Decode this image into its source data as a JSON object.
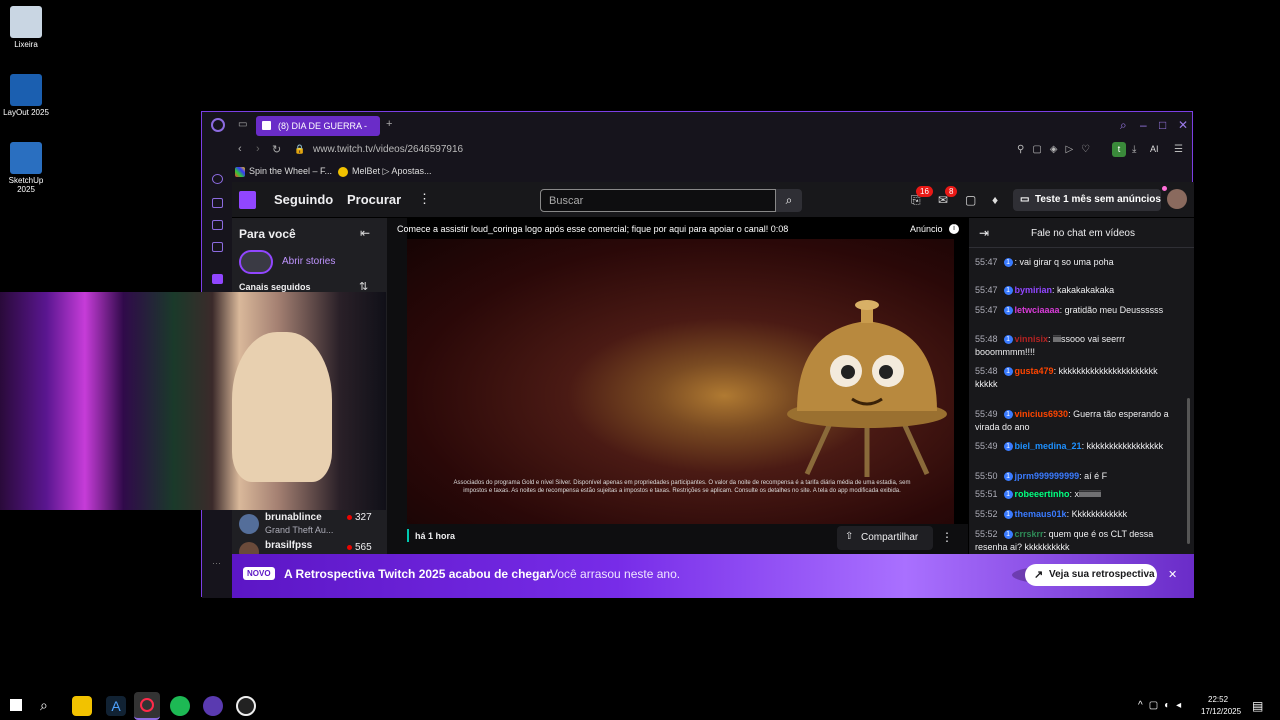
{
  "desktop": {
    "icons": [
      "Lixeira",
      "LayOut 2025",
      "SketchUp 2025"
    ]
  },
  "browser": {
    "tab_title": "(8) DIA DE GUERRA - ",
    "url": "www.twitch.tv/videos/2646597916",
    "bookmarks": [
      "Spin the Wheel – F...",
      "MelBet ▷ Apostas..."
    ],
    "ai_label": "AI"
  },
  "twitch": {
    "nav": {
      "following": "Seguindo",
      "browse": "Procurar",
      "search_placeholder": "Buscar",
      "notif_count": "16",
      "inbox_count": "8",
      "turbo": "Teste 1 mês sem anúncios"
    },
    "left": {
      "for_you": "Para você",
      "stories": "Abrir stories",
      "followed": "Canais seguidos",
      "channels": [
        {
          "name": "brunablince",
          "game": "Grand Theft Au...",
          "viewers": "327"
        },
        {
          "name": "brasilfpss",
          "viewers": "565"
        }
      ]
    },
    "video": {
      "ad_banner": "Comece a assistir loud_coringa logo após esse comercial; fique por aqui para apoiar o canal! 0:08",
      "ad_label": "Anúncio",
      "disclaimer": "Associados do programa Gold e nível Silver. Disponível apenas em propriedades participantes. O valor da noite de recompensa é a tarifa diária média de uma estadia, sem impostos e taxas. As noites de recompensa estão sujeitas a impostos e taxas. Restrições se aplicam. Consulte os detalhes no site. A tela do app modificada exibida.",
      "time_ago": "há 1 hora",
      "share": "Compartilhar"
    },
    "chat": {
      "header": "Fale no chat em vídeos",
      "messages": [
        {
          "time": "55:47",
          "user": "",
          "color": "#3a7bff",
          "text": ": vai girar q so uma poha"
        },
        {
          "time": "55:47",
          "user": "bymirian",
          "color": "#9146ff",
          "text": ": kakakakakaka"
        },
        {
          "time": "55:47",
          "user": "letwciaaaa",
          "color": "#d83cd8",
          "text": ": gratidão meu Deussssss"
        },
        {
          "time": "55:48",
          "user": "vinnisix",
          "color": "#b22222",
          "text": ": iiiissooo vai seerrr booommmm!!!!"
        },
        {
          "time": "55:48",
          "user": "gusta479",
          "color": "#ff4500",
          "text": ": kkkkkkkkkkkkkkkkkkkkkk kkkkk"
        },
        {
          "time": "55:49",
          "user": "vinicius6930",
          "color": "#ff4500",
          "text": ": Guerra tão esperando a virada do ano"
        },
        {
          "time": "55:49",
          "user": "biel_medina_21",
          "color": "#1e90ff",
          "text": ": kkkkkkkkkkkkkkkkk"
        },
        {
          "time": "55:50",
          "user": "jprm999999999",
          "color": "#3a7bff",
          "text": ": aí é F"
        },
        {
          "time": "55:51",
          "user": "robeeertinho",
          "color": "#00ff7f",
          "text": ": xiiiiiiiiiii"
        },
        {
          "time": "55:52",
          "user": "themaus01k",
          "color": "#3a7bff",
          "text": ": Kkkkkkkkkkkk"
        },
        {
          "time": "55:52",
          "user": "crrskrr",
          "color": "#2e8b57",
          "text": ": quem que é os CLT dessa resenha ai? kkkkkkkkkk"
        }
      ]
    },
    "promo": {
      "badge": "NOVO",
      "title": "A Retrospectiva Twitch 2025 acabou de chegar.",
      "subtitle": "Você arrasou neste ano.",
      "button": "Veja sua retrospectiva"
    }
  },
  "taskbar": {
    "time": "22:52",
    "date": "17/12/2025"
  }
}
